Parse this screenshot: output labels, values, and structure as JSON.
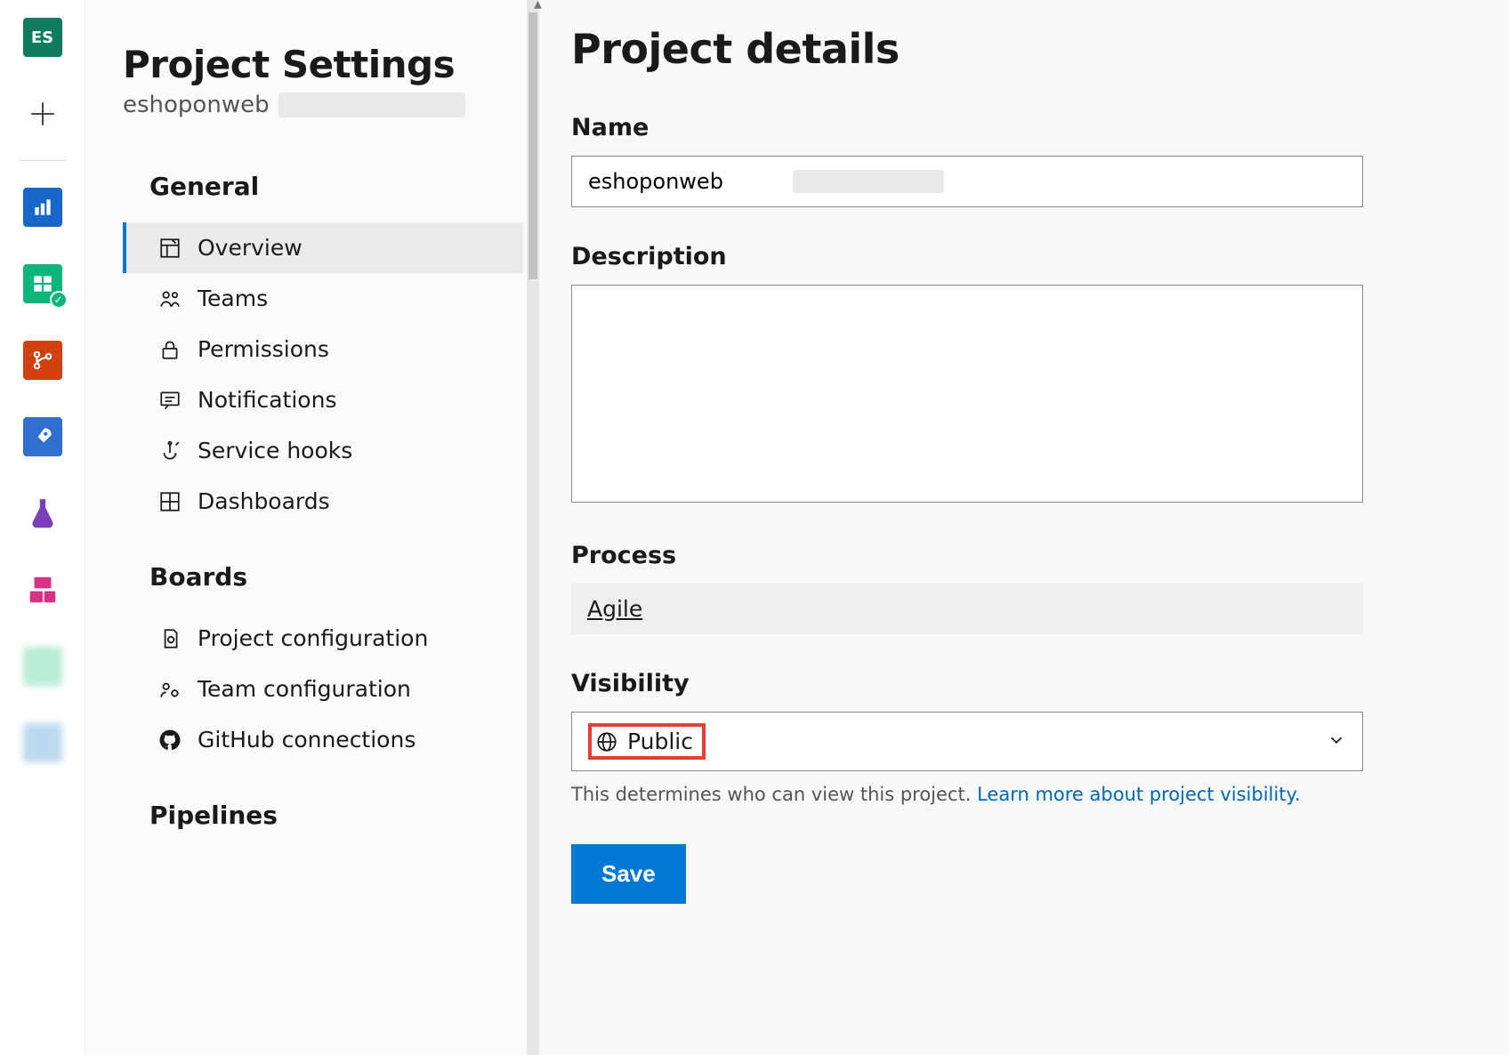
{
  "rail": {
    "project_initials": "ES",
    "tiles": [
      {
        "name": "project-tile",
        "bg": "#0f7b5f",
        "kind": "initials"
      },
      {
        "name": "add-project-tile",
        "bg": "transparent",
        "kind": "plus"
      },
      {
        "name": "boards-tile",
        "bg": "#0067c0",
        "kind": "chart"
      },
      {
        "name": "work-tile",
        "bg": "#0eb57a",
        "kind": "board",
        "badge": true
      },
      {
        "name": "repos-tile",
        "bg": "#d14010",
        "kind": "branch"
      },
      {
        "name": "pipelines-tile",
        "bg": "#2f6fd0",
        "kind": "rocket"
      },
      {
        "name": "test-tile",
        "bg": "#7b3fb8",
        "kind": "flask"
      },
      {
        "name": "artifacts-tile",
        "bg": "#d63384",
        "kind": "boxes"
      },
      {
        "name": "faded-tile-1",
        "bg": "#b9ecd6",
        "kind": "blur"
      },
      {
        "name": "faded-tile-2",
        "bg": "#bcd9ef",
        "kind": "blur"
      }
    ]
  },
  "sidebar": {
    "title": "Project Settings",
    "project_name_prefix": "eshoponweb",
    "groups": [
      {
        "header": "General",
        "items": [
          {
            "label": "Overview",
            "icon": "overview",
            "selected": true
          },
          {
            "label": "Teams",
            "icon": "teams"
          },
          {
            "label": "Permissions",
            "icon": "lock"
          },
          {
            "label": "Notifications",
            "icon": "chat"
          },
          {
            "label": "Service hooks",
            "icon": "hook"
          },
          {
            "label": "Dashboards",
            "icon": "dashboard"
          }
        ]
      },
      {
        "header": "Boards",
        "items": [
          {
            "label": "Project configuration",
            "icon": "gearpage"
          },
          {
            "label": "Team configuration",
            "icon": "teamgear"
          },
          {
            "label": "GitHub connections",
            "icon": "github"
          }
        ]
      },
      {
        "header": "Pipelines",
        "items": []
      }
    ]
  },
  "details": {
    "heading": "Project details",
    "name_label": "Name",
    "name_value": "eshoponweb",
    "description_label": "Description",
    "description_value": "",
    "process_label": "Process",
    "process_value": "Agile",
    "visibility_label": "Visibility",
    "visibility_value": "Public",
    "visibility_help_prefix": "This determines who can view this project. ",
    "visibility_help_link": "Learn more about project visibility.",
    "save_label": "Save"
  }
}
